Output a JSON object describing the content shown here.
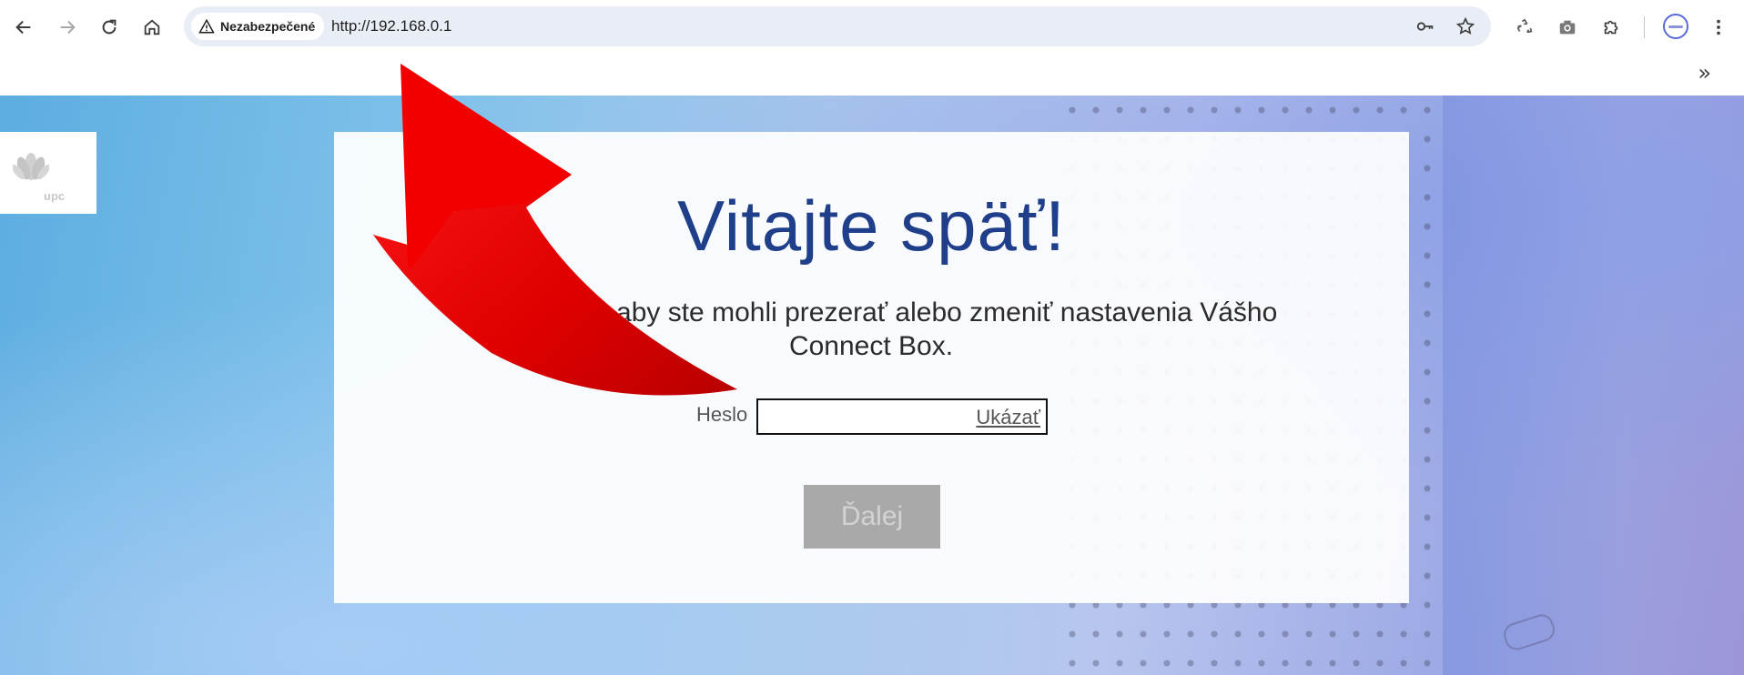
{
  "browser": {
    "security_label": "Nezabezpečené",
    "url": "http://192.168.0.1",
    "more_bookmarks_glyph": "»",
    "icons": {
      "back": "arrow-left-icon",
      "forward": "arrow-right-icon",
      "reload": "reload-icon",
      "home": "home-icon",
      "warning": "warning-triangle-icon",
      "password": "key-icon",
      "bookmark": "star-icon",
      "recycle": "recycle-icon",
      "screenshot": "camera-icon",
      "extensions": "puzzle-icon",
      "menu": "kebab-menu-icon"
    }
  },
  "page": {
    "logo_text": "upc",
    "title": "Vitajte späť!",
    "subtitle": "Prihlásiť sa, aby ste mohli prezerať alebo zmeniť nastavenia Vášho Connect Box.",
    "password_label": "Heslo",
    "password_value": "",
    "show_password": "Ukázať",
    "next_button": "Ďalej"
  },
  "colors": {
    "title": "#1f3f8a",
    "next_button_bg": "#a9a9a9",
    "annotation_arrow": "#e00000"
  }
}
